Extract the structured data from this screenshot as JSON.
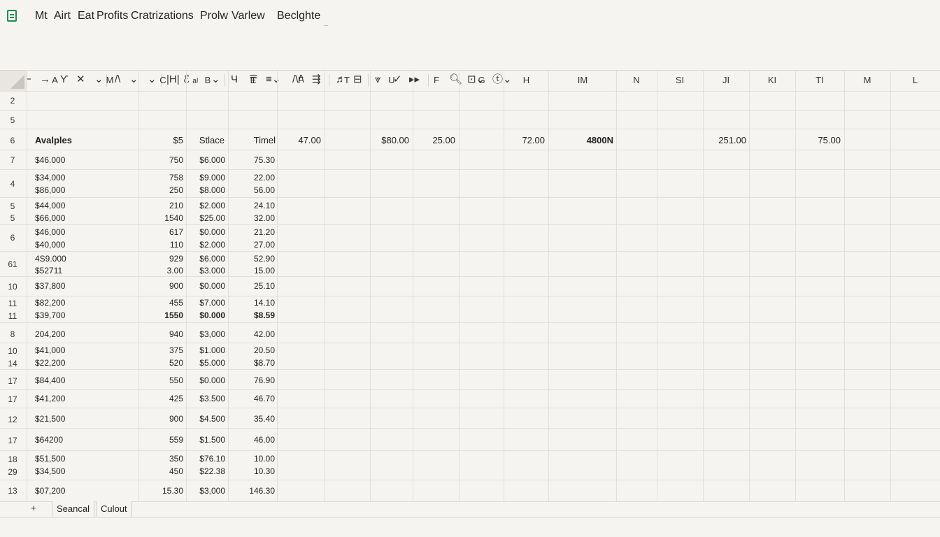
{
  "menu": [
    "Mt",
    "Airt",
    "Eat",
    "Profits",
    "Cratrizations",
    "Prolw",
    "Varlew",
    "Beclghte"
  ],
  "toolbar": [
    "←",
    "−",
    "→",
    "Ƴ",
    "✕",
    "⌄",
    "/\\",
    "⌄",
    "⌄",
    "|H|",
    "ℰ ₐₗ",
    "⌄",
    "Ч",
    "〒",
    "≡⌄",
    "/\\/\\",
    "⇶",
    "♬",
    "⊟",
    "⩔",
    "✓",
    "▸▸",
    "🔍︎",
    "⊡⌄",
    "ⓣ⌄"
  ],
  "columns": [
    "A",
    "M",
    "C",
    "B",
    "E",
    "F",
    "T",
    "U",
    "F",
    "G",
    "H",
    "IM",
    "N",
    "SI",
    "JI",
    "KI",
    "TI",
    "M",
    "L"
  ],
  "row_numbers": [
    [
      "2"
    ],
    [
      "5"
    ],
    [
      "6"
    ],
    [
      "7"
    ],
    [
      "4"
    ],
    [
      "5",
      "5"
    ],
    [
      "6"
    ],
    [
      "61"
    ],
    [
      "10"
    ],
    [
      "11",
      "11"
    ],
    [
      "8"
    ],
    [
      "10",
      "14"
    ],
    [
      "17"
    ],
    [
      "17"
    ],
    [
      "12"
    ],
    [
      "17"
    ],
    [
      "18",
      "29"
    ],
    [
      "13"
    ]
  ],
  "header_row": {
    "a": "Avalples",
    "c": "$5",
    "b": "Stlace",
    "e": "Timel",
    "f": "47.00",
    "u": "$80.00",
    "f2": "25.00",
    "h": "72.00",
    "im": "4800N",
    "ji": "251.00",
    "ti": "75.00"
  },
  "rows": [
    {
      "a": [
        "$46.000"
      ],
      "c": [
        "750"
      ],
      "b": [
        "$6.000"
      ],
      "e": [
        "75.30"
      ]
    },
    {
      "a": [
        "$34,000",
        "$86,000"
      ],
      "c": [
        "758",
        "250"
      ],
      "b": [
        "$9.000",
        "$8.000"
      ],
      "e": [
        "22.00",
        "56.00"
      ]
    },
    {
      "a": [
        "$44,000",
        "$66,000"
      ],
      "c": [
        "210",
        "1540"
      ],
      "b": [
        "$2.000",
        "$25.00"
      ],
      "e": [
        "24.10",
        "32.00"
      ]
    },
    {
      "a": [
        "$46,000",
        "$40,000"
      ],
      "c": [
        "617",
        "110"
      ],
      "b": [
        "$0.000",
        "$2.000"
      ],
      "e": [
        "21.20",
        "27.00"
      ]
    },
    {
      "a": [
        "4S9.000",
        "$52711"
      ],
      "c": [
        "929",
        "3.00"
      ],
      "b": [
        "$6.000",
        "$3.000"
      ],
      "e": [
        "52.90",
        "15.00"
      ]
    },
    {
      "a": [
        "$37,800"
      ],
      "c": [
        "900"
      ],
      "b": [
        "$0.000"
      ],
      "e": [
        "25.10"
      ]
    },
    {
      "a": [
        "$82,200",
        "$39,700"
      ],
      "c": [
        "455",
        "1550"
      ],
      "b": [
        "$7.000",
        "$0.000"
      ],
      "e": [
        "14.10",
        "$8.59"
      ],
      "bold_second": true
    },
    {
      "a": [
        "204,200"
      ],
      "c": [
        "940"
      ],
      "b": [
        "$3,000"
      ],
      "e": [
        "42.00"
      ]
    },
    {
      "a": [
        "$41,000",
        "$22,200"
      ],
      "c": [
        "375",
        "520"
      ],
      "b": [
        "$1.000",
        "$5.000"
      ],
      "e": [
        "20.50",
        "$8.70"
      ]
    },
    {
      "a": [
        "$84,400"
      ],
      "c": [
        "550"
      ],
      "b": [
        "$0.000"
      ],
      "e": [
        "76.90"
      ]
    },
    {
      "a": [
        "$41,200"
      ],
      "c": [
        "425"
      ],
      "b": [
        "$3.500"
      ],
      "e": [
        "46.70"
      ]
    },
    {
      "a": [
        "$21,500"
      ],
      "c": [
        "900"
      ],
      "b": [
        "$4.500"
      ],
      "e": [
        "35.40"
      ]
    },
    {
      "a": [
        "$64200"
      ],
      "c": [
        "559"
      ],
      "b": [
        "$1.500"
      ],
      "e": [
        "46.00"
      ]
    },
    {
      "a": [
        "$51,500",
        "$34,500"
      ],
      "c": [
        "350",
        "450"
      ],
      "b": [
        "$76.10",
        "$22.38"
      ],
      "e": [
        "10.00",
        "10.30"
      ]
    },
    {
      "a": [
        "$07,200"
      ],
      "c": [
        "15.30"
      ],
      "b": [
        "$3,000"
      ],
      "e": [
        "146.30"
      ]
    }
  ],
  "sheet_tabs": {
    "add": "+",
    "tabs": [
      "Seancal",
      "Culout"
    ]
  }
}
